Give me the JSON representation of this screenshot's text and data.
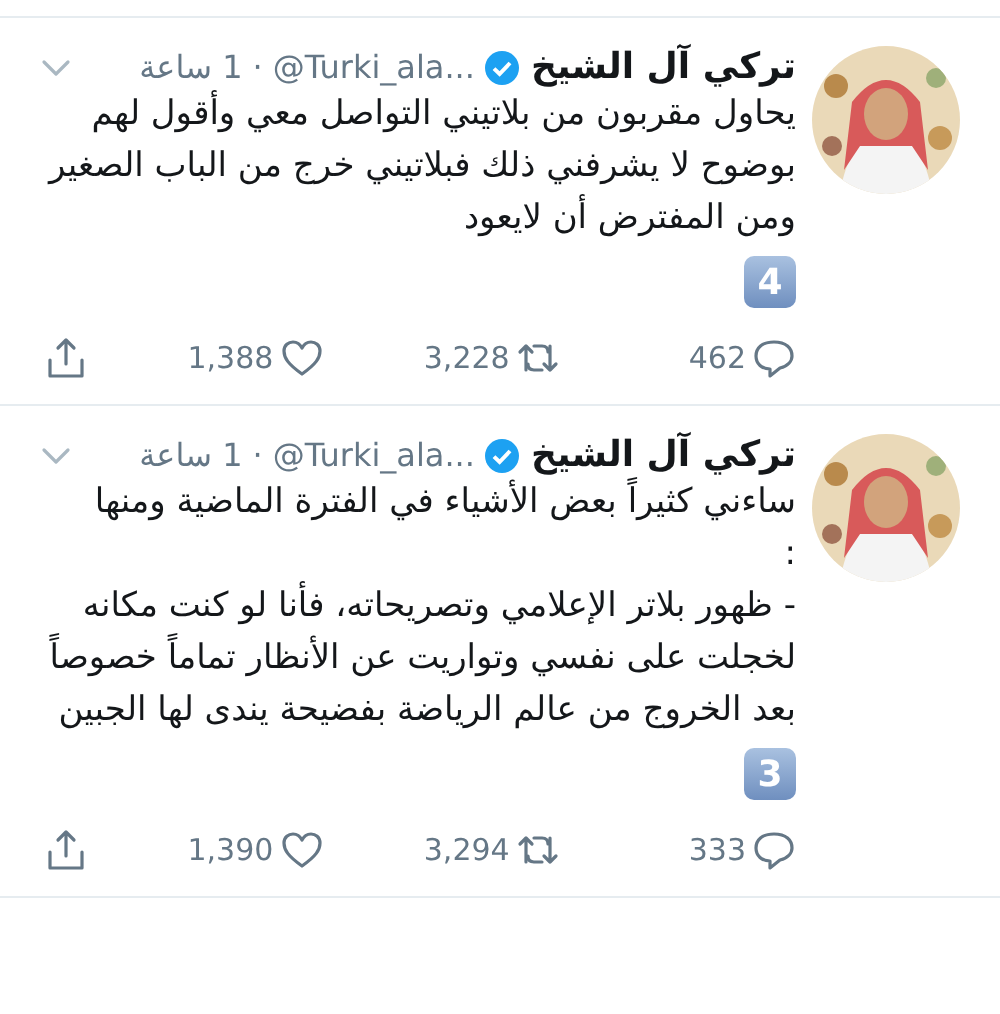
{
  "tweets": [
    {
      "name": "تركي آل الشيخ",
      "verified": true,
      "handle": "@Turki_ala...",
      "separator": "·",
      "time": "1 ساعة",
      "paragraphs": [
        "يحاول مقربون من بلاتيني التواصل معي وأقول لهم بوضوح لا يشرفني ذلك فبلاتيني خرج من الباب الصغير ومن المفترض أن لايعود"
      ],
      "number": "4",
      "replies": "462",
      "retweets": "3,228",
      "likes": "1,388"
    },
    {
      "name": "تركي آل الشيخ",
      "verified": true,
      "handle": "@Turki_ala...",
      "separator": "·",
      "time": "1 ساعة",
      "paragraphs": [
        "ساءني كثيراً بعض الأشياء في الفترة الماضية ومنها",
        ":",
        "- ظهور بلاتر الإعلامي وتصريحاته، فأنا لو كنت مكانه لخجلت على نفسي وتواريت عن الأنظار تماماً خصوصاً بعد الخروج من عالم الرياضة بفضيحة يندى لها الجبين"
      ],
      "number": "3",
      "replies": "333",
      "retweets": "3,294",
      "likes": "1,390"
    }
  ]
}
